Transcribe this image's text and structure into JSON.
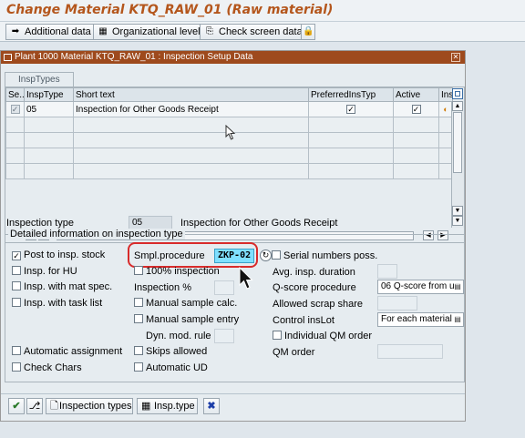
{
  "window": {
    "title": "Change Material KTQ_RAW_01 (Raw material)"
  },
  "toolbar": {
    "additional_data": "Additional data",
    "org_levels": "Organizational levels",
    "check_screen": "Check screen data"
  },
  "dialog": {
    "title": "Plant 1000 Material KTQ_RAW_01 : Inspection Setup Data",
    "tab": "InspTypes",
    "table": {
      "headers": [
        "Se..",
        "InspType",
        "Short text",
        "PreferredInsTyp",
        "Active",
        "Ins"
      ],
      "rows": [
        {
          "insp_type": "05",
          "short_text": "Inspection for Other Goods Receipt",
          "preferred": true,
          "active": true
        }
      ]
    }
  },
  "insp_type": {
    "label": "Inspection type",
    "value": "05",
    "description": "Inspection for Other Goods Receipt"
  },
  "details": {
    "group_title": "Detailed information on inspection type",
    "post_to_insp_stock": "Post to insp. stock",
    "insp_for_hu": "Insp. for HU",
    "insp_with_mat_spec": "Insp. with mat spec.",
    "insp_with_task_list": "Insp. with task list",
    "automatic_assignment": "Automatic assignment",
    "check_chars": "Check Chars",
    "smpl_procedure_label": "Smpl.procedure",
    "smpl_procedure_value": "ZKP-02",
    "serial_numbers": "Serial numbers poss.",
    "hundred_pct": "100% inspection",
    "insp_pct": "Inspection %",
    "manual_sample_calc": "Manual sample calc.",
    "manual_sample_entry": "Manual sample entry",
    "dyn_mod_rule": "Dyn. mod. rule",
    "skips_allowed": "Skips allowed",
    "automatic_ud": "Automatic UD",
    "avg_insp_duration": "Avg. insp. duration",
    "q_score_procedure": "Q-score procedure",
    "q_score_value": "06 Q-score from u",
    "allowed_scrap_share": "Allowed scrap share",
    "control_inslot": "Control insLot",
    "control_inslot_value": "For each material",
    "individual_qm_order": "Individual QM order",
    "qm_order": "QM order"
  },
  "footer": {
    "inspection_types": "Inspection types",
    "insp_type": "Insp.type"
  },
  "colors": {
    "title_text": "#b4561c",
    "dialog_title_bg": "#9e4a1d",
    "highlight_border": "#d82b2b",
    "field_highlight": "#7fe0ff"
  }
}
